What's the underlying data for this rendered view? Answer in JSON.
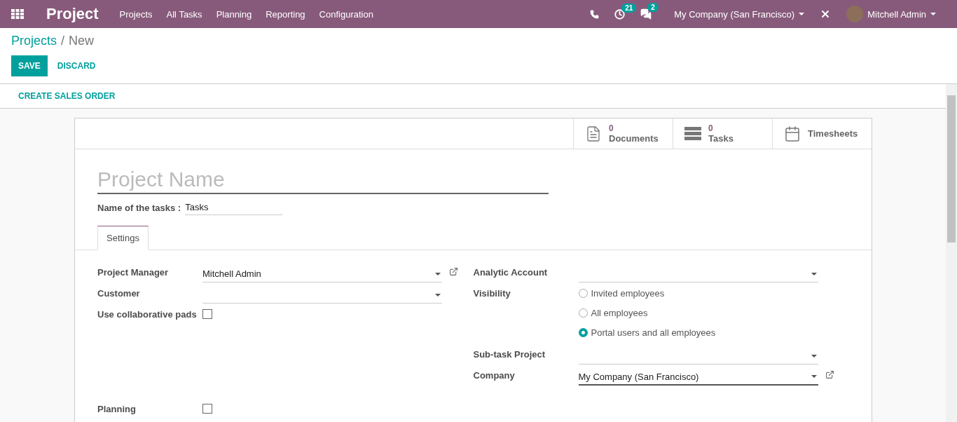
{
  "navbar": {
    "app_title": "Project",
    "menu": [
      "Projects",
      "All Tasks",
      "Planning",
      "Reporting",
      "Configuration"
    ],
    "activity_count": "21",
    "message_count": "2",
    "company": "My Company (San Francisco)",
    "user": "Mitchell Admin"
  },
  "breadcrumb": {
    "parent": "Projects",
    "separator": "/",
    "current": "New"
  },
  "actions": {
    "save": "SAVE",
    "discard": "DISCARD"
  },
  "header_buttons": [
    "CREATE SALES ORDER"
  ],
  "smart_buttons": [
    {
      "kind": "documents",
      "count": "0",
      "label": "Documents"
    },
    {
      "kind": "tasks",
      "count": "0",
      "label": "Tasks"
    },
    {
      "kind": "timesheets",
      "label": "Timesheets"
    }
  ],
  "form": {
    "name_placeholder": "Project Name",
    "tasks_label": "Name of the tasks :",
    "tasks_value": "Tasks",
    "tabs": [
      {
        "label": "Settings",
        "selected": true
      }
    ],
    "left_fields": [
      {
        "kind": "select",
        "label": "Project Manager",
        "value": "Mitchell Admin",
        "external_link": true
      },
      {
        "kind": "select",
        "label": "Customer",
        "external_link": false
      },
      {
        "kind": "checkbox",
        "label": "Use collaborative pads",
        "checked": false
      }
    ],
    "right_fields": [
      {
        "kind": "select",
        "label": "Analytic Account",
        "external_link": false
      },
      {
        "kind": "radio",
        "label": "Visibility",
        "options": [
          {
            "label": "Invited employees",
            "selected": false
          },
          {
            "label": "All employees",
            "selected": false
          },
          {
            "label": "Portal users and all employees",
            "selected": true
          }
        ]
      },
      {
        "kind": "select",
        "label": "Sub-task Project",
        "external_link": false
      },
      {
        "kind": "select",
        "label": "Company",
        "value": "My Company (San Francisco)",
        "external_link": true,
        "focused": true
      }
    ],
    "bottom_fields": [
      {
        "kind": "checkbox",
        "label": "Planning",
        "checked": false
      }
    ]
  }
}
